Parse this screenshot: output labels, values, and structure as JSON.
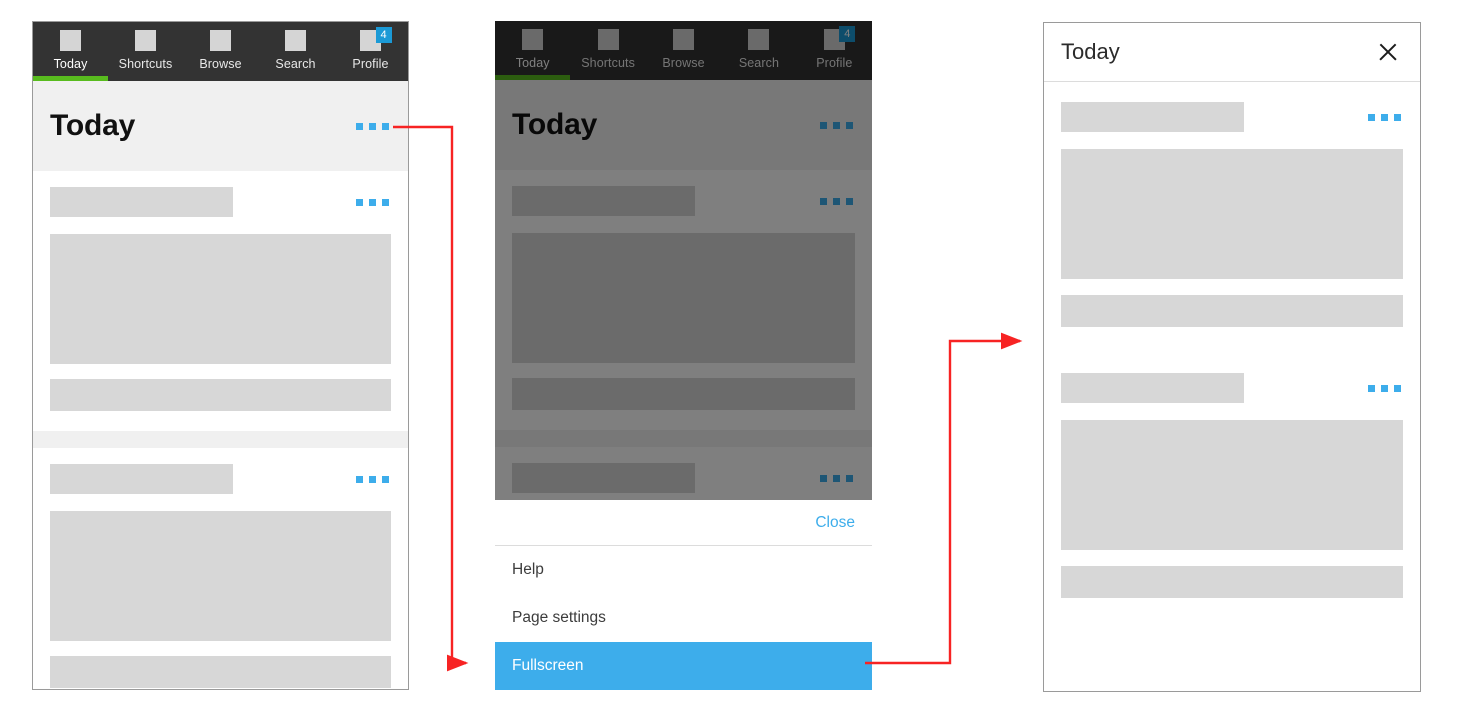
{
  "accent": {
    "blue": "#3dadeb",
    "badge_blue": "#1b9ad6",
    "green": "#58bb1e",
    "dark_bar": "#333333",
    "placeholder_grey": "#d7d7d7",
    "header_grey": "#f0f0f0",
    "arrow_red": "#f72323"
  },
  "tabs": [
    {
      "label": "Today",
      "icon": "square-icon",
      "active": true,
      "badge": ""
    },
    {
      "label": "Shortcuts",
      "icon": "square-icon",
      "active": false,
      "badge": ""
    },
    {
      "label": "Browse",
      "icon": "square-icon",
      "active": false,
      "badge": ""
    },
    {
      "label": "Search",
      "icon": "square-icon",
      "active": false,
      "badge": ""
    },
    {
      "label": "Profile",
      "icon": "square-icon",
      "active": false,
      "badge": "4"
    }
  ],
  "panel1": {
    "name": "default-state",
    "page_title": "Today",
    "overflow_icon": "kebab-menu-icon"
  },
  "panel2": {
    "name": "menu-open-state",
    "page_title": "Today",
    "overflow_icon": "kebab-menu-icon",
    "sheet": {
      "close_label": "Close",
      "items": [
        {
          "label": "Help",
          "selected": false
        },
        {
          "label": "Page settings",
          "selected": false
        },
        {
          "label": "Fullscreen",
          "selected": true
        }
      ]
    }
  },
  "panel3": {
    "name": "fullscreen-state",
    "modal_title": "Today",
    "close_icon": "close-x-icon",
    "overflow_icon": "kebab-menu-icon"
  },
  "annotations": {
    "arrow1": "overflow-menu-opens-action-sheet",
    "arrow2": "fullscreen-opens-modal"
  }
}
